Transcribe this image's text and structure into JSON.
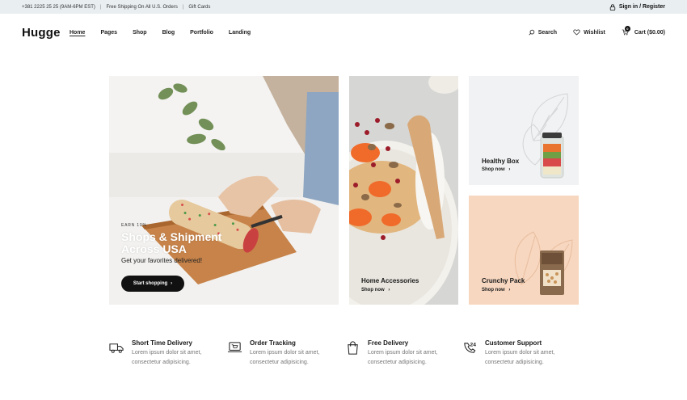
{
  "topbar": {
    "phone": "+381 2225 25 25 (9AM-6PM EST)",
    "shipping": "Free Shipping On All U.S. Orders",
    "gift": "Gift Cards",
    "sep": "|",
    "signin": "Sign in / Register"
  },
  "header": {
    "logo": "Hugge",
    "nav": [
      "Home",
      "Pages",
      "Shop",
      "Blog",
      "Portfolio",
      "Landing"
    ],
    "search": "Search",
    "wishlist": "Wishlist",
    "cart": "Cart ($0.00)",
    "cart_count": "0"
  },
  "hero": {
    "eyebrow": "EARN 10%",
    "title_line1": "Shops & Shipment",
    "title_line2": "Across USA",
    "subtitle": "Get your favorites delivered!",
    "button": "Start shopping",
    "arrow": "›"
  },
  "cards": [
    {
      "title": "Home Accessories",
      "link": "Shop now",
      "arrow": "›"
    },
    {
      "title": "Healthy Box",
      "link": "Shop now",
      "arrow": "›"
    },
    {
      "title": "Crunchy Pack",
      "link": "Shop now",
      "arrow": "›"
    }
  ],
  "features": [
    {
      "icon": "truck-icon",
      "title": "Short Time Delivery",
      "desc1": "Lorem ipsum dolor sit amet,",
      "desc2": "consectetur adipisicing."
    },
    {
      "icon": "laptop-cart-icon",
      "title": "Order Tracking",
      "desc1": "Lorem ipsum dolor sit amet,",
      "desc2": "consectetur adipisicing."
    },
    {
      "icon": "shopping-bag-icon",
      "title": "Free Delivery",
      "desc1": "Lorem ipsum dolor sit amet,",
      "desc2": "consectetur adipisicing."
    },
    {
      "icon": "phone-24-icon",
      "title": "Customer Support",
      "desc1": "Lorem ipsum dolor sit amet,",
      "desc2": "consectetur adipisicing."
    }
  ],
  "colors": {
    "topbar_bg": "#e9eef1",
    "dark": "#111111",
    "peach": "#f7d7c0",
    "light_panel": "#f1f2f3"
  }
}
